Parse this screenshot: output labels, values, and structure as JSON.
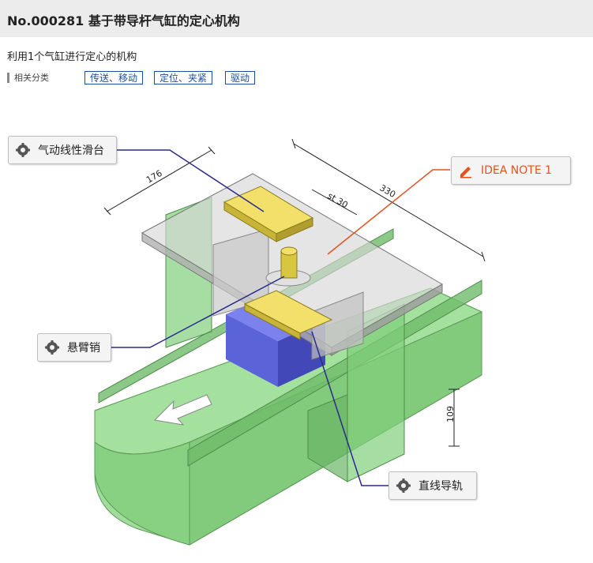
{
  "page": {
    "title": "No.000281 基于带导杆气缸的定心机构",
    "subtitle": "利用1个气缸进行定心的机构",
    "category_label": "相关分类",
    "tags": [
      "传送、移动",
      "定位、夹紧",
      "驱动"
    ]
  },
  "callouts": {
    "slide": "气动线性滑台",
    "idea": "IDEA NOTE 1",
    "pin": "悬臂销",
    "rail": "直线导轨"
  },
  "dimensions": {
    "d176": "176",
    "d330": "330",
    "stroke": "st 30",
    "d109": "109"
  },
  "colors": {
    "conveyor": "#8fd68a",
    "block": "#5b63d8",
    "leader": "#2a2a8c",
    "idea": "#e0531e",
    "tag": "#1c4f9c"
  },
  "icons": {
    "callout_icon": "gear-icon",
    "idea_icon": "pencil-icon",
    "direction": "arrow-icon"
  }
}
